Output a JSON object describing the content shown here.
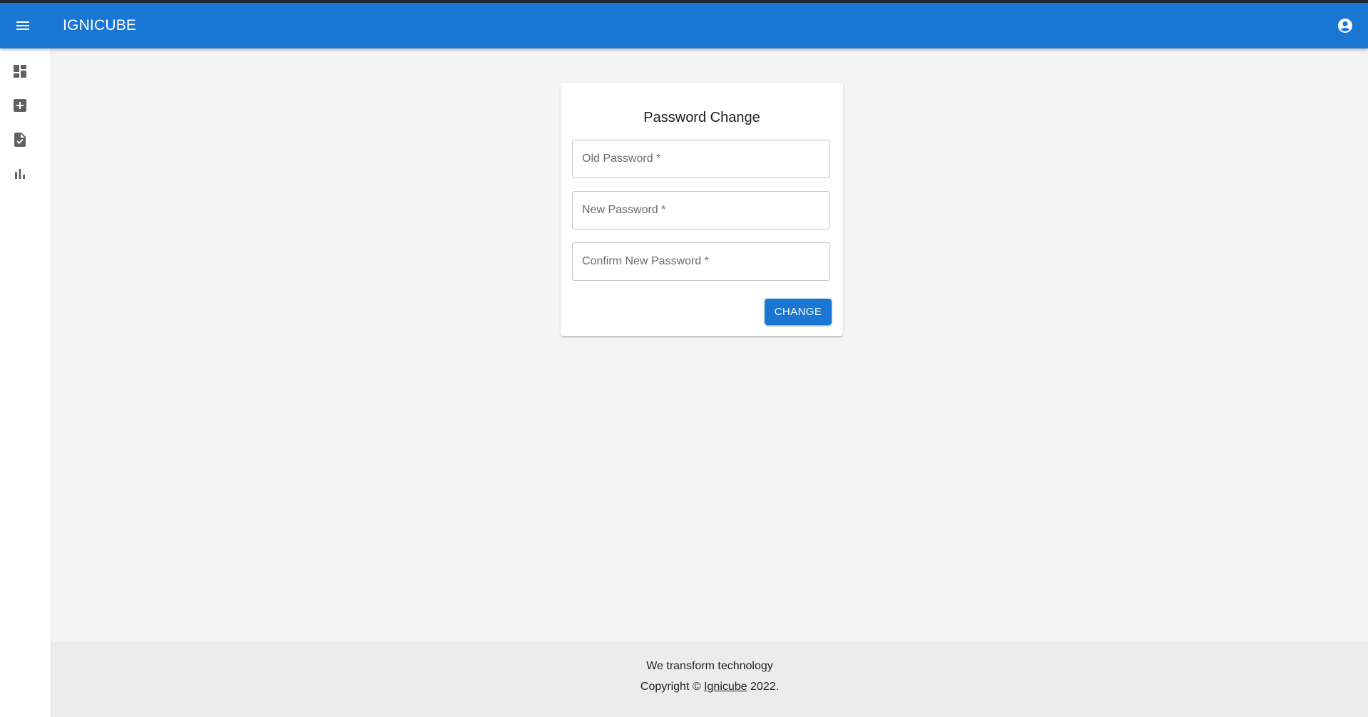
{
  "app": {
    "title": "IGNICUBE",
    "colors": {
      "primary": "#1976d2",
      "background": "#f4f4f4",
      "footer": "#ececec"
    }
  },
  "appbar": {
    "menu_icon": "menu-icon",
    "account_icon": "account-circle-icon"
  },
  "sidebar": {
    "items": [
      {
        "icon": "dashboard-icon"
      },
      {
        "icon": "add-box-icon"
      },
      {
        "icon": "task-file-icon"
      },
      {
        "icon": "bar-chart-icon"
      }
    ]
  },
  "form": {
    "title": "Password Change",
    "old_password": {
      "placeholder": "Old Password *",
      "value": ""
    },
    "new_password": {
      "placeholder": "New Password *",
      "value": ""
    },
    "confirm_password": {
      "placeholder": "Confirm New Password *",
      "value": ""
    },
    "submit_label": "CHANGE"
  },
  "footer": {
    "tagline": "We transform technology",
    "copyright_prefix": "Copyright © ",
    "company_link": "Ignicube",
    "copyright_suffix": " 2022."
  }
}
